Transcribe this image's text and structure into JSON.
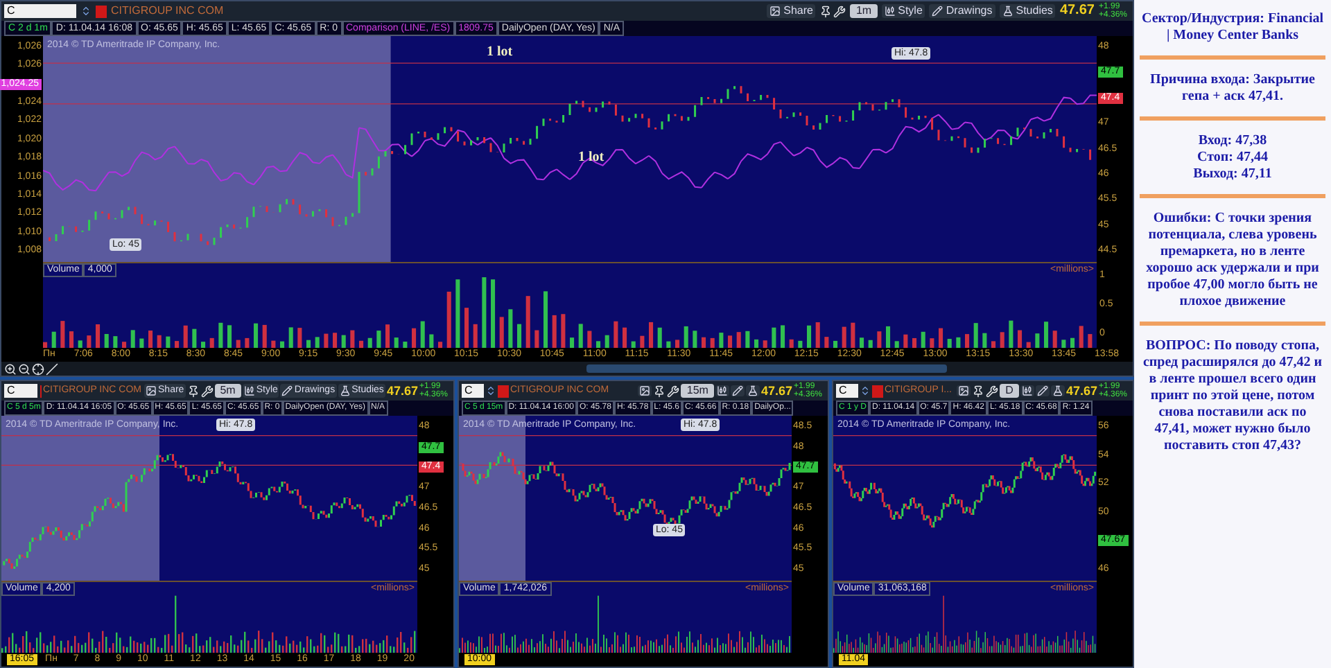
{
  "charts": [
    {
      "symbol": "C",
      "company": "CITIGROUP INC COM",
      "buttons": [
        {
          "kind": "share",
          "label": "Share"
        },
        {
          "kind": "tools"
        },
        {
          "kind": "interval",
          "label": "1m"
        },
        {
          "kind": "style",
          "label": "Style"
        },
        {
          "kind": "drawings",
          "label": "Drawings"
        },
        {
          "kind": "studies",
          "label": "Studies"
        }
      ],
      "price": "47.67",
      "change": "+1.99",
      "change_pct": "+4.36%",
      "info": [
        {
          "kind": "symbol",
          "text": "C 2 d 1m"
        },
        {
          "kind": "field",
          "text": "D: 11.04.14 16:08"
        },
        {
          "kind": "field",
          "text": "O: 45.65"
        },
        {
          "kind": "field",
          "text": "H: 45.65"
        },
        {
          "kind": "field",
          "text": "L: 45.65"
        },
        {
          "kind": "field",
          "text": "C: 45.65"
        },
        {
          "kind": "field",
          "text": "R: 0"
        },
        {
          "kind": "comparison",
          "text": "Comparison (LINE, /ES)"
        },
        {
          "kind": "comparison",
          "text": "1809.75"
        },
        {
          "kind": "field",
          "text": "DailyOpen (DAY, Yes)"
        },
        {
          "kind": "field",
          "text": "N/A"
        }
      ],
      "copyright": "2014 © TD Ameritrade IP Company, Inc.",
      "left_axis": [
        {
          "kind": "tick",
          "text": "1,026"
        },
        {
          "kind": "tick",
          "text": "1,026"
        },
        {
          "kind": "badge",
          "text": "1,024.25"
        },
        {
          "kind": "tick",
          "text": "1,024"
        },
        {
          "kind": "tick",
          "text": "1,022"
        },
        {
          "kind": "tick",
          "text": "1,020"
        },
        {
          "kind": "tick",
          "text": "1,018"
        },
        {
          "kind": "tick",
          "text": "1,016"
        },
        {
          "kind": "tick",
          "text": "1,014"
        },
        {
          "kind": "tick",
          "text": "1,012"
        },
        {
          "kind": "tick",
          "text": "1,010"
        },
        {
          "kind": "tick",
          "text": "1,008"
        }
      ],
      "price_axis": [
        {
          "kind": "tick",
          "text": "48"
        },
        {
          "kind": "last",
          "text": "47.7"
        },
        {
          "kind": "level",
          "text": "47.4"
        },
        {
          "kind": "tick",
          "text": "47"
        },
        {
          "kind": "tick",
          "text": "46.5"
        },
        {
          "kind": "tick",
          "text": "46"
        },
        {
          "kind": "tick",
          "text": "45.5"
        },
        {
          "kind": "tick",
          "text": "45"
        },
        {
          "kind": "tick",
          "text": "44.5"
        }
      ],
      "annotations": [
        {
          "kind": "note",
          "text": "1 lot"
        },
        {
          "kind": "note",
          "text": "1 lot"
        },
        {
          "kind": "bubble",
          "text": "Hi: 47.8"
        },
        {
          "kind": "bubble",
          "text": "Lo: 45"
        }
      ],
      "volume": {
        "label": "Volume",
        "value": "4,000",
        "units": "<millions>",
        "axis": [
          "1",
          "0.5",
          "0"
        ]
      },
      "time_axis": [
        "Пн",
        "7:06",
        "8:00",
        "8:15",
        "8:30",
        "8:45",
        "9:00",
        "9:15",
        "9:30",
        "9:45",
        "10:00",
        "10:15",
        "10:30",
        "10:45",
        "11:00",
        "11:15",
        "11:30",
        "11:45",
        "12:00",
        "12:15",
        "12:30",
        "12:45",
        "13:00",
        "13:15",
        "13:30",
        "13:45",
        "13:58"
      ]
    },
    {
      "symbol": "C",
      "company": "CITIGROUP INC COM",
      "buttons": [
        {
          "kind": "share",
          "label": "Share"
        },
        {
          "kind": "tools"
        },
        {
          "kind": "interval",
          "label": "5m"
        },
        {
          "kind": "style",
          "label": "Style"
        },
        {
          "kind": "drawings",
          "label": "Drawings"
        },
        {
          "kind": "studies",
          "label": "Studies"
        }
      ],
      "price": "47.67",
      "change": "+1.99",
      "change_pct": "+4.36%",
      "info": [
        {
          "kind": "symbol",
          "text": "C 5 d 5m"
        },
        {
          "kind": "field",
          "text": "D: 11.04.14 16:05"
        },
        {
          "kind": "field",
          "text": "O: 45.65"
        },
        {
          "kind": "field",
          "text": "H: 45.65"
        },
        {
          "kind": "field",
          "text": "L: 45.65"
        },
        {
          "kind": "field",
          "text": "C: 45.65"
        },
        {
          "kind": "field",
          "text": "R: 0"
        },
        {
          "kind": "field",
          "text": "DailyOpen (DAY, Yes)"
        },
        {
          "kind": "field",
          "text": "N/A"
        }
      ],
      "copyright": "2014 © TD Ameritrade IP Company, Inc.",
      "price_axis": [
        {
          "kind": "tick",
          "text": "48"
        },
        {
          "kind": "last",
          "text": "47.7"
        },
        {
          "kind": "level",
          "text": "47.4"
        },
        {
          "kind": "tick",
          "text": "47"
        },
        {
          "kind": "tick",
          "text": "46.5"
        },
        {
          "kind": "tick",
          "text": "46"
        },
        {
          "kind": "tick",
          "text": "45.5"
        },
        {
          "kind": "tick",
          "text": "45"
        }
      ],
      "annotations": [
        {
          "kind": "bubble",
          "text": "Hi: 47.8"
        }
      ],
      "volume": {
        "label": "Volume",
        "value": "4,200",
        "units": "<millions>"
      },
      "time_cursor": "16:05",
      "time_axis": [
        "Пн",
        "7",
        "8",
        "9",
        "10",
        "11",
        "12",
        "13",
        "14",
        "15",
        "16",
        "17",
        "18",
        "19",
        "20"
      ]
    },
    {
      "symbol": "C",
      "company": "CITIGROUP INC COM",
      "buttons": [
        {
          "kind": "share"
        },
        {
          "kind": "tools"
        },
        {
          "kind": "interval",
          "label": "15m"
        },
        {
          "kind": "style"
        },
        {
          "kind": "drawings"
        },
        {
          "kind": "studies"
        }
      ],
      "price": "47.67",
      "change": "+1.99",
      "change_pct": "+4.36%",
      "info": [
        {
          "kind": "symbol",
          "text": "C 5 d 15m"
        },
        {
          "kind": "field",
          "text": "D: 11.04.14 16:00"
        },
        {
          "kind": "field",
          "text": "O: 45.78"
        },
        {
          "kind": "field",
          "text": "H: 45.78"
        },
        {
          "kind": "field",
          "text": "L: 45.6"
        },
        {
          "kind": "field",
          "text": "C: 45.66"
        },
        {
          "kind": "field",
          "text": "R: 0.18"
        },
        {
          "kind": "field",
          "text": "DailyOp..."
        }
      ],
      "copyright": "2014 © TD Ameritrade IP Company, Inc.",
      "price_axis": [
        {
          "kind": "tick",
          "text": "48.5"
        },
        {
          "kind": "tick",
          "text": "48"
        },
        {
          "kind": "last",
          "text": "47.7"
        },
        {
          "kind": "tick",
          "text": "47"
        },
        {
          "kind": "tick",
          "text": "46.5"
        },
        {
          "kind": "tick",
          "text": "46"
        },
        {
          "kind": "tick",
          "text": "45.5"
        },
        {
          "kind": "tick",
          "text": "45"
        }
      ],
      "annotations": [
        {
          "kind": "bubble",
          "text": "Hi: 47.8"
        },
        {
          "kind": "bubble",
          "text": "Lo: 45"
        }
      ],
      "volume": {
        "label": "Volume",
        "value": "1,742,026",
        "units": "<millions>"
      },
      "time_cursor": "10:00"
    },
    {
      "symbol": "C",
      "company": "CITIGROUP I...",
      "buttons": [
        {
          "kind": "share"
        },
        {
          "kind": "tools"
        },
        {
          "kind": "interval",
          "label": "D"
        },
        {
          "kind": "style"
        },
        {
          "kind": "drawings"
        },
        {
          "kind": "studies"
        }
      ],
      "price": "47.67",
      "change": "+1.99",
      "change_pct": "+4.36%",
      "info": [
        {
          "kind": "symbol",
          "text": "C 1 y D"
        },
        {
          "kind": "field",
          "text": "D: 11.04.14"
        },
        {
          "kind": "field",
          "text": "O: 45.7"
        },
        {
          "kind": "field",
          "text": "H: 46.42"
        },
        {
          "kind": "field",
          "text": "L: 45.18"
        },
        {
          "kind": "field",
          "text": "C: 45.68"
        },
        {
          "kind": "field",
          "text": "R: 1.24"
        }
      ],
      "copyright": "2014 © TD Ameritrade IP Company, Inc.",
      "price_axis": [
        {
          "kind": "tick",
          "text": "56"
        },
        {
          "kind": "tick",
          "text": "54"
        },
        {
          "kind": "tick",
          "text": "52"
        },
        {
          "kind": "tick",
          "text": "50"
        },
        {
          "kind": "last",
          "text": "47.67"
        },
        {
          "kind": "tick",
          "text": "46"
        }
      ],
      "volume": {
        "label": "Volume",
        "value": "31,063,168",
        "units": "<millions>"
      },
      "time_cursor": "11.04"
    }
  ],
  "notes": [
    "Сектор/Индустрия: Financial | Money Center Banks",
    "Причина входа: Закрытие гепа + аск 47,41.",
    "Вход: 47,38\nСтоп: 47,44\nВыход: 47,11",
    "Ошибки: С точки зрения потенциала, слева уровень премаркета, но в ленте хорошо аск удержали и при пробое 47,00 могло быть не плохое движение",
    "ВОПРОС: По поводу стопа, спред расширялся до 47,42 и в ленте прошел всего один принт по этой цене, потом снова поставили аск по 47,41, может нужно было поставить стоп 47,43?"
  ]
}
